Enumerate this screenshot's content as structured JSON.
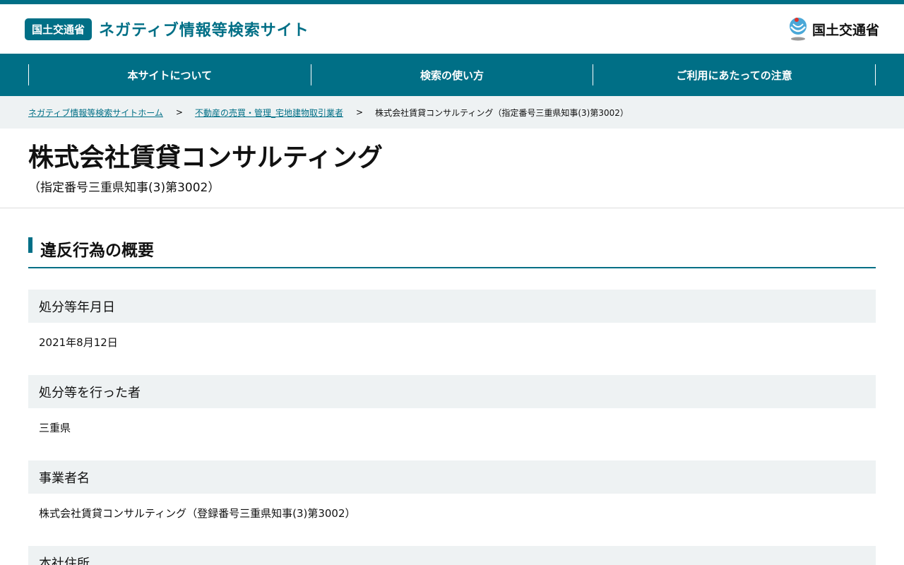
{
  "header": {
    "badge": "国土交通省",
    "site_title": "ネガティブ情報等検索サイト",
    "logo_text": "国土交通省"
  },
  "nav": {
    "items": [
      {
        "label": "本サイトについて"
      },
      {
        "label": "検索の使い方"
      },
      {
        "label": "ご利用にあたっての注意"
      }
    ]
  },
  "breadcrumb": {
    "home": "ネガティブ情報等検索サイトホーム",
    "category": "不動産の売買・管理_宅地建物取引業者",
    "current": "株式会社賃貸コンサルティング（指定番号三重県知事(3)第3002）",
    "separator": ">"
  },
  "page": {
    "title": "株式会社賃貸コンサルティング",
    "subtitle": "（指定番号三重県知事(3)第3002）"
  },
  "section": {
    "heading": "違反行為の概要",
    "fields": [
      {
        "label": "処分等年月日",
        "value": "2021年8月12日"
      },
      {
        "label": "処分等を行った者",
        "value": "三重県"
      },
      {
        "label": "事業者名",
        "value": "株式会社賃貸コンサルティング（登録番号三重県知事(3)第3002）"
      },
      {
        "label": "本社住所",
        "value": ""
      }
    ]
  },
  "colors": {
    "brand": "#006f86",
    "label_bg": "#eef2f3"
  }
}
